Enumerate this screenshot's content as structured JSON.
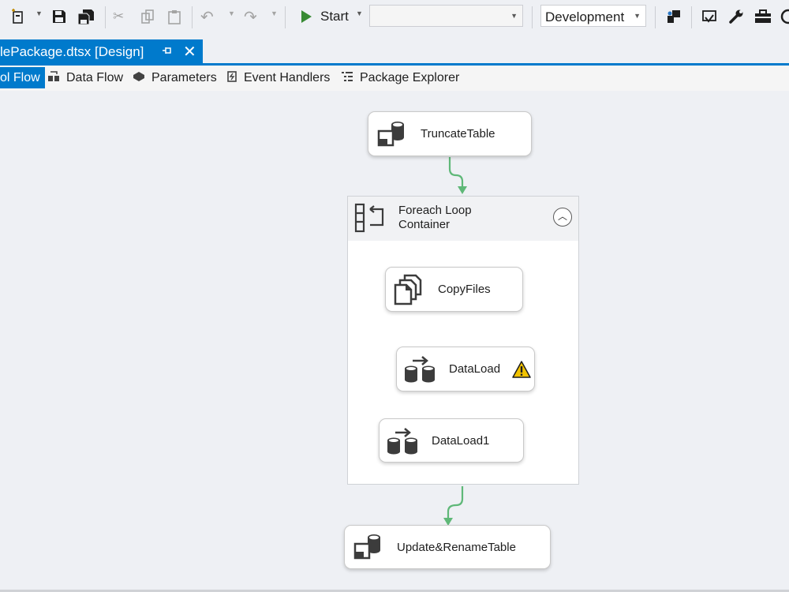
{
  "toolbar": {
    "start_label": "Start",
    "solution_config": "Development",
    "icons": [
      "new-item-icon",
      "save-icon",
      "save-all-icon",
      "cut-icon",
      "copy-icon",
      "paste-icon",
      "undo-icon",
      "redo-icon",
      "start-icon",
      "ssis-icon",
      "deploy-icon",
      "wrench-icon",
      "toolbox-icon"
    ]
  },
  "document_tab": {
    "title": "lePackage.dtsx [Design]"
  },
  "designer_tabs": [
    {
      "label": "ol Flow",
      "active": true
    },
    {
      "label": "Data Flow"
    },
    {
      "label": "Parameters"
    },
    {
      "label": "Event Handlers"
    },
    {
      "label": "Package Explorer"
    }
  ],
  "tasks": {
    "truncate": "TruncateTable",
    "container": "Foreach Loop Container",
    "copy_files": "CopyFiles",
    "data_load": "DataLoad",
    "data_load1": "DataLoad1",
    "update_rename": "Update&RenameTable"
  },
  "colors": {
    "accent": "#007acc",
    "precedence_success": "#5fb878",
    "warning": "#f2c300"
  }
}
